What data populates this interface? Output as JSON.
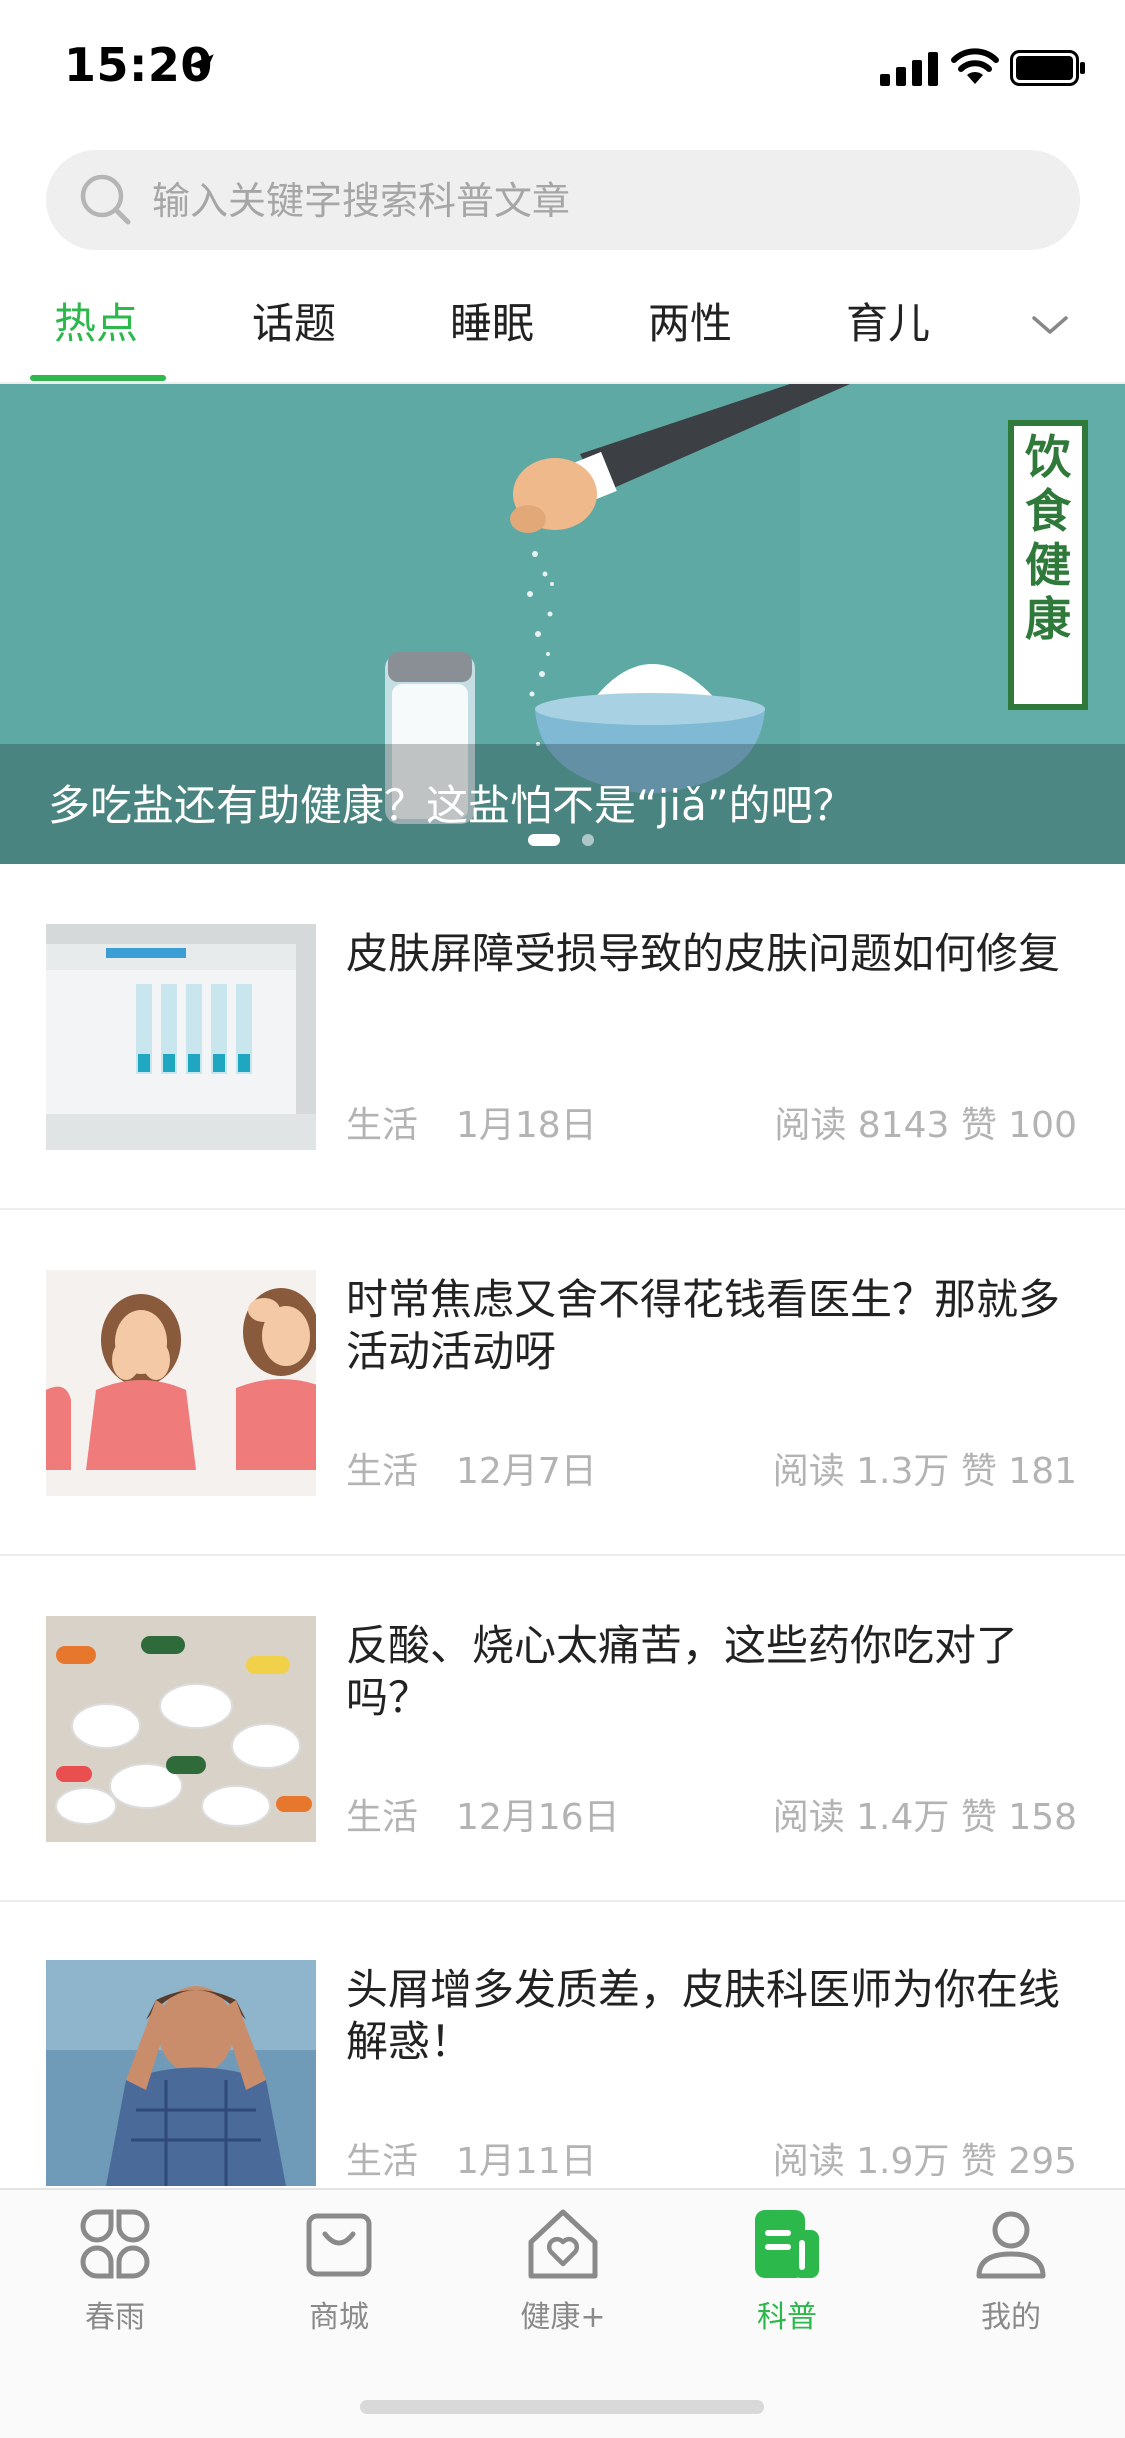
{
  "status_bar": {
    "time": "15:20"
  },
  "search": {
    "placeholder": "输入关键字搜索科普文章"
  },
  "tabs": [
    {
      "label": "热点",
      "active": true
    },
    {
      "label": "话题"
    },
    {
      "label": "睡眠"
    },
    {
      "label": "两性"
    },
    {
      "label": "育儿"
    }
  ],
  "banner": {
    "caption": "多吃盐还有助健康？这盐怕不是“jiǎ”的吧？",
    "sign_text": "饮食健康",
    "slides_total": 2,
    "active_slide": 1
  },
  "articles": [
    {
      "title": "皮肤屏障受损导致的皮肤问题如何修复",
      "category": "生活",
      "date": "1月18日",
      "stats": "阅读 8143  赞 100"
    },
    {
      "title": "时常焦虑又舍不得花钱看医生？那就多活动活动呀",
      "category": "生活",
      "date": "12月7日",
      "stats": "阅读 1.3万  赞 181"
    },
    {
      "title": "反酸、烧心太痛苦，这些药你吃对了吗？",
      "category": "生活",
      "date": "12月16日",
      "stats": "阅读 1.4万  赞 158"
    },
    {
      "title": "头屑增多发质差，皮肤科医师为你在线解惑！",
      "category": "生活",
      "date": "1月11日",
      "stats": "阅读 1.9万  赞 295"
    }
  ],
  "tabbar": [
    {
      "label": "春雨",
      "icon": "grid-icon"
    },
    {
      "label": "商城",
      "icon": "bag-icon"
    },
    {
      "label": "健康+",
      "icon": "house-heart-icon"
    },
    {
      "label": "科普",
      "icon": "article-icon",
      "active": true
    },
    {
      "label": "我的",
      "icon": "person-icon"
    }
  ],
  "colors": {
    "accent": "#2db84c",
    "banner_bg": "#5fa9a5"
  }
}
